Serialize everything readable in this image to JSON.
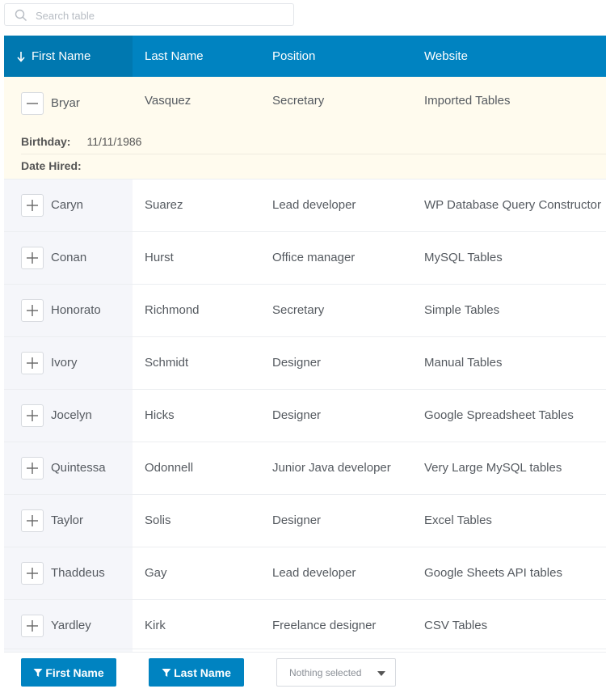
{
  "search": {
    "placeholder": "Search table",
    "value": ""
  },
  "columns": [
    "First Name",
    "Last Name",
    "Position",
    "Website"
  ],
  "expanded_row": {
    "first": "Bryar",
    "last": "Vasquez",
    "position": "Secretary",
    "website": "Imported Tables",
    "details": [
      {
        "label": "Birthday",
        "value": "11/11/1986"
      },
      {
        "label": "Date Hired",
        "value": ""
      }
    ]
  },
  "rows": [
    {
      "first": "Caryn",
      "last": "Suarez",
      "position": "Lead developer",
      "website": "WP Database Query Constructor"
    },
    {
      "first": "Conan",
      "last": "Hurst",
      "position": "Office manager",
      "website": "MySQL Tables"
    },
    {
      "first": "Honorato",
      "last": "Richmond",
      "position": "Secretary",
      "website": "Simple Tables"
    },
    {
      "first": "Ivory",
      "last": "Schmidt",
      "position": "Designer",
      "website": "Manual Tables"
    },
    {
      "first": "Jocelyn",
      "last": "Hicks",
      "position": "Designer",
      "website": "Google Spreadsheet Tables"
    },
    {
      "first": "Quintessa",
      "last": "Odonnell",
      "position": "Junior Java developer",
      "website": "Very Large MySQL tables"
    },
    {
      "first": "Taylor",
      "last": "Solis",
      "position": "Designer",
      "website": "Excel Tables"
    },
    {
      "first": "Thaddeus",
      "last": "Gay",
      "position": "Lead developer",
      "website": "Google Sheets API tables"
    },
    {
      "first": "Yardley",
      "last": "Kirk",
      "position": "Freelance designer",
      "website": "CSV Tables"
    }
  ],
  "footer": {
    "filter_first": "First Name",
    "filter_last": "Last Name",
    "select_value": "Nothing selected"
  },
  "colors": {
    "header": "#0083c1",
    "sidebar_col": "#f5f6fa",
    "expanded": "#fffbee"
  },
  "icons": {
    "search": "search-icon",
    "sort": "arrow-down-icon",
    "collapse": "minus-icon",
    "expand": "plus-icon",
    "filter": "filter-icon",
    "dropdown": "caret-down-icon"
  }
}
